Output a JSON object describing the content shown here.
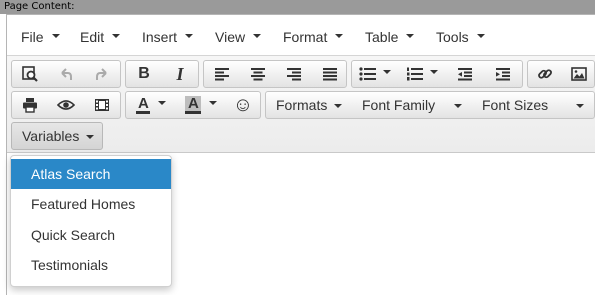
{
  "titlebar": {
    "label": "Page Content:"
  },
  "menubar": {
    "items": [
      {
        "label": "File"
      },
      {
        "label": "Edit"
      },
      {
        "label": "Insert"
      },
      {
        "label": "View"
      },
      {
        "label": "Format"
      },
      {
        "label": "Table"
      },
      {
        "label": "Tools"
      }
    ]
  },
  "toolbar": {
    "bold_label": "B",
    "italic_label": "I",
    "text_color_label": "A",
    "bg_color_label": "A",
    "emoticons_glyph": "☺",
    "formats_label": "Formats",
    "font_family_label": "Font Family",
    "font_sizes_label": "Font Sizes",
    "variables_label": "Variables"
  },
  "dropdown": {
    "items": [
      {
        "label": "Atlas Search",
        "active": true
      },
      {
        "label": "Featured Homes"
      },
      {
        "label": "Quick Search"
      },
      {
        "label": "Testimonials"
      }
    ]
  },
  "colors": {
    "accent": "#2a88c8",
    "titlebar": "#9a9a9a"
  }
}
